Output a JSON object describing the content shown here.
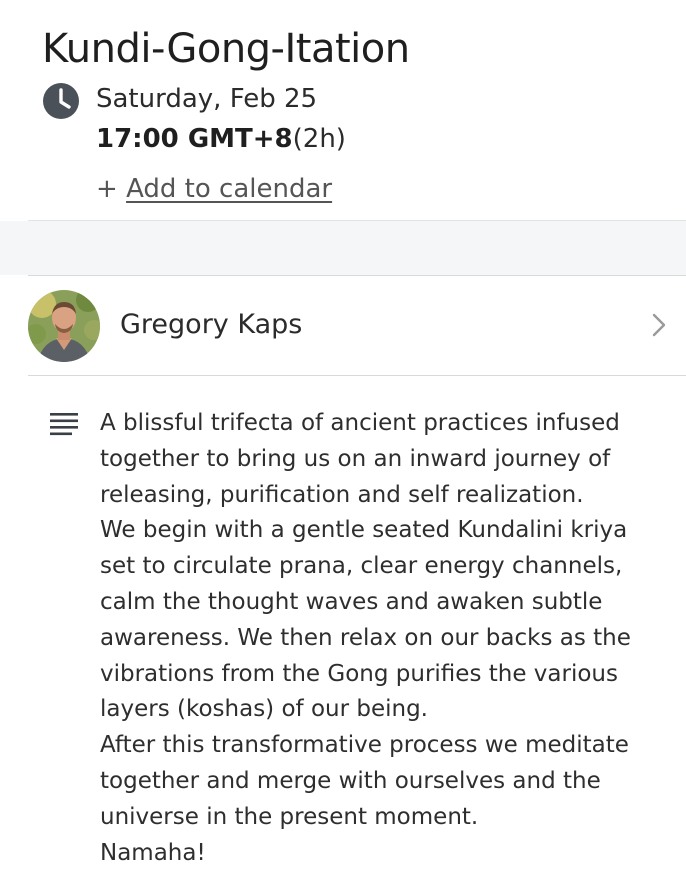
{
  "event": {
    "title": "Kundi-Gong-Itation",
    "date": "Saturday, Feb 25",
    "time_bold": "17:00 GMT+8",
    "duration": "(2h)",
    "add_prefix": "+ ",
    "add_calendar_label": "Add to calendar"
  },
  "host": {
    "name": "Gregory Kaps",
    "avatar_icon": "person-avatar"
  },
  "description": {
    "icon": "description-lines-icon",
    "text": "A blissful trifecta of ancient practices infused\ntogether to bring us on an inward journey of\nreleasing, purification and self realization.\nWe begin with a gentle seated Kundalini kriya\nset to circulate prana, clear energy channels,\ncalm the thought waves and awaken subtle\nawareness. We then relax on our backs as the\nvibrations from the Gong purifies the various\nlayers (koshas) of our being.\nAfter this transformative process we meditate\ntogether and merge with ourselves and the\nuniverse in the present moment.\nNamaha!"
  },
  "colors": {
    "icon_gray": "#4a5159",
    "band": "#f5f6f7",
    "divider": "#d9d9d9"
  }
}
